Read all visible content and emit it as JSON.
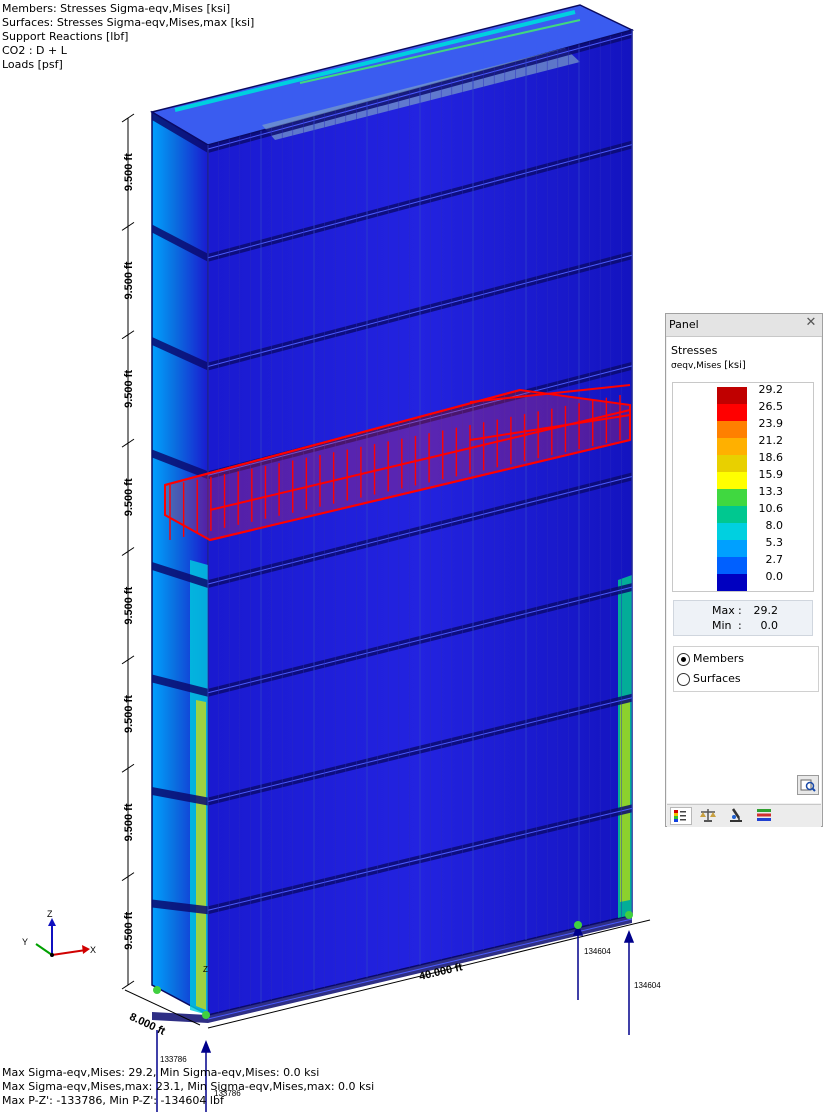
{
  "header": {
    "lines": [
      "Members: Stresses Sigma-eqv,Mises [ksi]",
      "Surfaces: Stresses Sigma-eqv,Mises,max [ksi]",
      "Support Reactions [lbf]",
      "CO2 : D + L",
      "Loads [psf]"
    ]
  },
  "footer": {
    "lines": [
      "Max Sigma-eqv,Mises: 29.2, Min Sigma-eqv,Mises: 0.0 ksi",
      "Max Sigma-eqv,Mises,max: 23.1, Min Sigma-eqv,Mises,max: 0.0 ksi",
      "Max P-Z': -133786, Min P-Z': -134604 lbf"
    ]
  },
  "dimensions": {
    "story_height": "9.500 ft",
    "story_count": 8,
    "length": "40.000 ft",
    "width": "8.000 ft"
  },
  "reactions": {
    "left_a": "133786",
    "left_b": "133786",
    "right_a": "134604",
    "right_b": "134604"
  },
  "axes": {
    "x": "X",
    "y": "Y",
    "z": "Z",
    "z_small": "Z"
  },
  "panel": {
    "title": "Panel",
    "close_icon": "close-icon",
    "heading": "Stresses",
    "subtitle": "σeqv,Mises",
    "unit": "[ksi]",
    "legend": [
      {
        "value": "29.2",
        "color": "#c00000"
      },
      {
        "value": "26.5",
        "color": "#ff0000"
      },
      {
        "value": "23.9",
        "color": "#ff8000"
      },
      {
        "value": "21.2",
        "color": "#ffb000"
      },
      {
        "value": "18.6",
        "color": "#e8d000"
      },
      {
        "value": "15.9",
        "color": "#ffff00"
      },
      {
        "value": "13.3",
        "color": "#40d840"
      },
      {
        "value": "10.6",
        "color": "#00c890"
      },
      {
        "value": "8.0",
        "color": "#00d0e0"
      },
      {
        "value": "5.3",
        "color": "#00a0ff"
      },
      {
        "value": "2.7",
        "color": "#0060ff"
      },
      {
        "value": "0.0",
        "color": "#0000c0"
      }
    ],
    "max_label": "Max",
    "max_value": "29.2",
    "min_label": "Min",
    "min_value": "0.0",
    "options": [
      {
        "label": "Members",
        "selected": true
      },
      {
        "label": "Surfaces",
        "selected": false
      }
    ],
    "tabs": [
      "color-scale-icon",
      "balance-icon",
      "microscope-icon",
      "layers-icon"
    ]
  },
  "colors": {
    "structure_fill": "#1f1fd8",
    "structure_dark": "#0a0a70",
    "load_red": "#ff0000",
    "accent_cyan": "#00d0e0"
  }
}
